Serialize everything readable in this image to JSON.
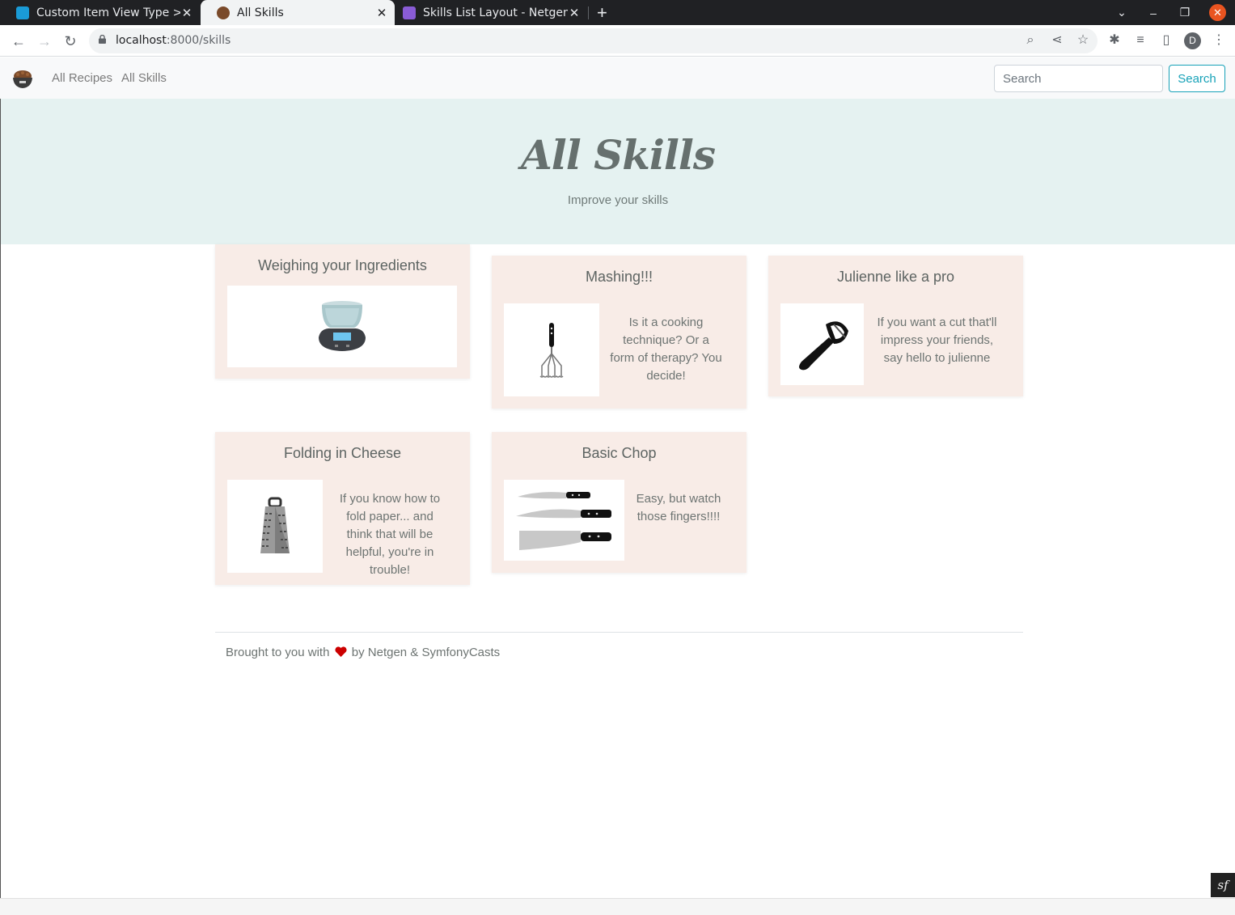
{
  "browser": {
    "tabs": [
      {
        "title": "Custom Item View Type > ",
        "active": false
      },
      {
        "title": "All Skills",
        "active": true
      },
      {
        "title": "Skills List Layout - Netgen",
        "active": false
      }
    ],
    "url_host": "localhost",
    "url_path": ":8000/skills",
    "profile_initial": "D"
  },
  "site": {
    "nav": {
      "recipes": "All Recipes",
      "skills": "All Skills"
    },
    "search": {
      "placeholder": "Search",
      "button": "Search"
    },
    "hero": {
      "title": "All Skills",
      "subtitle": "Improve your skills"
    },
    "cards": [
      {
        "title": "Weighing your Ingredients",
        "image": "kitchen-scale",
        "text": ""
      },
      {
        "title": "Mashing!!!",
        "image": "potato-masher",
        "text": "Is it a cooking technique? Or a form of therapy? You decide!"
      },
      {
        "title": "Julienne like a pro",
        "image": "vegetable-peeler",
        "text": "If you want a cut that'll impress your friends, say hello to julienne"
      },
      {
        "title": "Folding in Cheese",
        "image": "cheese-grater",
        "text": "If you know how to fold paper... and think that will be helpful, you're in trouble!"
      },
      {
        "title": "Basic Chop",
        "image": "kitchen-knives",
        "text": "Easy, but watch those fingers!!!!"
      }
    ],
    "footer": {
      "before": "Brought to you with",
      "after": "by Netgen & SymfonyCasts"
    }
  },
  "colors": {
    "hero_bg": "#e5f2f1",
    "card_bg": "#f8ece7",
    "accent": "#17a2b8",
    "heart": "#cc0000"
  }
}
